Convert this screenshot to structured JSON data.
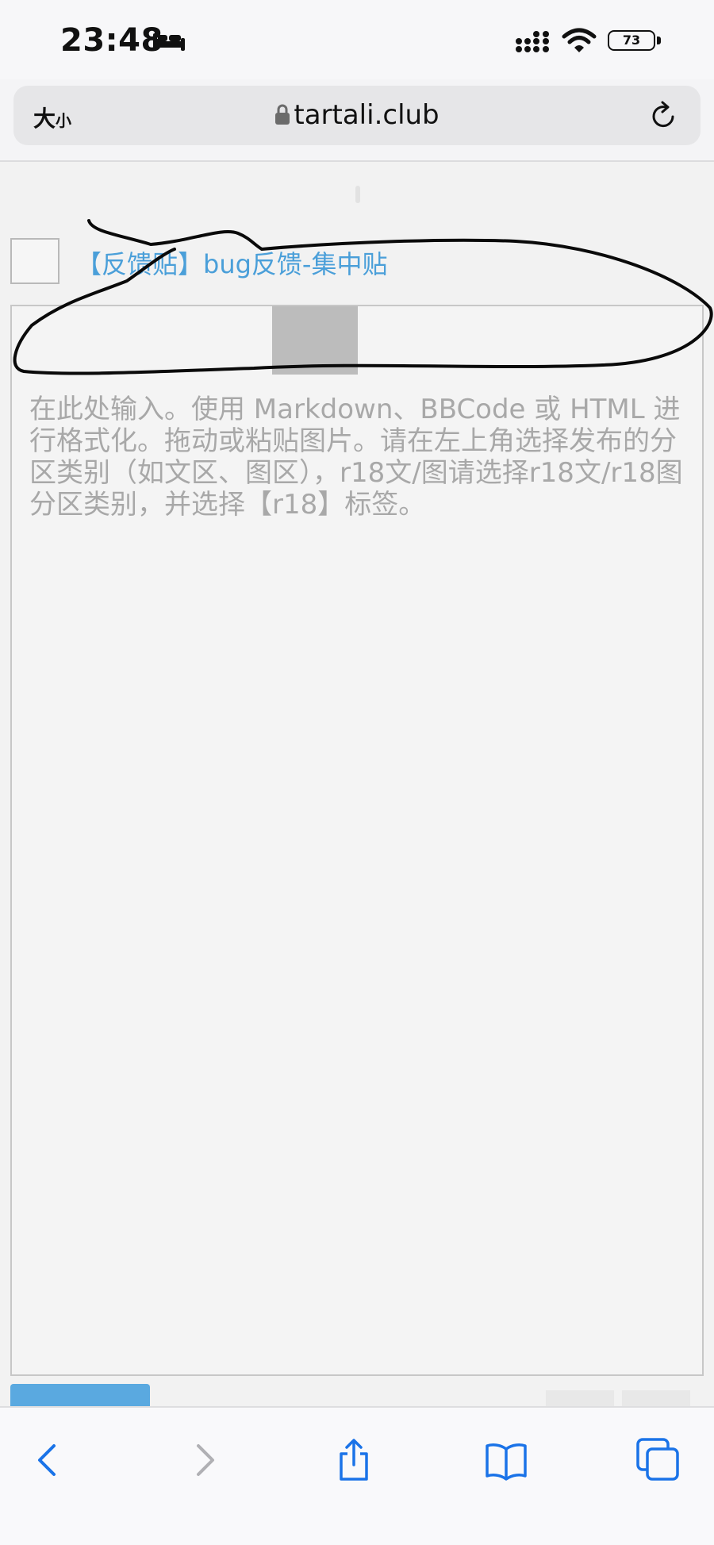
{
  "status_bar": {
    "time": "23:48",
    "battery": "73"
  },
  "address_bar": {
    "text_size_big": "大",
    "text_size_small": "小",
    "url": "tartali.club"
  },
  "thread": {
    "link_label": "【反馈贴】bug反馈-集中贴"
  },
  "editor": {
    "placeholder": "在此处输入。使用 Markdown、BBCode 或 HTML 进行格式化。拖动或粘贴图片。请在左上角选择发布的分区类别（如文区、图区），r18文/图请选择r18文/r18图分区类别，并选择【r18】标签。"
  },
  "colors": {
    "link": "#4a9fd9",
    "accent": "#5aa9e0",
    "ios_blue": "#1a73e8"
  },
  "icons": [
    "bed-icon",
    "signal-icon",
    "wifi-icon",
    "lock-icon",
    "reload-icon",
    "back-icon",
    "forward-icon",
    "share-icon",
    "bookmarks-icon",
    "tabs-icon"
  ]
}
